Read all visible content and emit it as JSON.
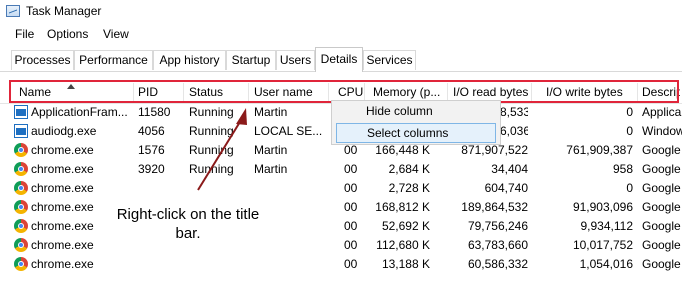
{
  "window": {
    "title": "Task Manager"
  },
  "menu": [
    "File",
    "Options",
    "View"
  ],
  "tabs": [
    "Processes",
    "Performance",
    "App history",
    "Startup",
    "Users",
    "Details",
    "Services"
  ],
  "active_tab": "Details",
  "columns": [
    "Name",
    "PID",
    "Status",
    "User name",
    "CPU",
    "Memory (p...",
    "I/O read bytes",
    "I/O write bytes",
    "Descrip"
  ],
  "rows": [
    {
      "name": "ApplicationFram...",
      "pid": "11580",
      "status": "Running",
      "user": "Martin",
      "cpu": "",
      "memory": "",
      "io_read": "8,533",
      "io_write": "0",
      "desc": "Applica",
      "icon": "window-app-icon"
    },
    {
      "name": "audiodg.exe",
      "pid": "4056",
      "status": "Running",
      "user": "LOCAL SE...",
      "cpu": "",
      "memory": "",
      "io_read": "6,036",
      "io_write": "0",
      "desc": "Window",
      "icon": "window-app-icon"
    },
    {
      "name": "chrome.exe",
      "pid": "1576",
      "status": "Running",
      "user": "Martin",
      "cpu": "00",
      "memory": "166,448 K",
      "io_read": "871,907,522",
      "io_write": "761,909,387",
      "desc": "Google",
      "icon": "chrome-icon"
    },
    {
      "name": "chrome.exe",
      "pid": "3920",
      "status": "Running",
      "user": "Martin",
      "cpu": "00",
      "memory": "2,684 K",
      "io_read": "34,404",
      "io_write": "958",
      "desc": "Google",
      "icon": "chrome-icon"
    },
    {
      "name": "chrome.exe",
      "pid": "",
      "status": "",
      "user": "",
      "cpu": "00",
      "memory": "2,728 K",
      "io_read": "604,740",
      "io_write": "0",
      "desc": "Google",
      "icon": "chrome-icon"
    },
    {
      "name": "chrome.exe",
      "pid": "",
      "status": "",
      "user": "",
      "cpu": "00",
      "memory": "168,812 K",
      "io_read": "189,864,532",
      "io_write": "91,903,096",
      "desc": "Google",
      "icon": "chrome-icon"
    },
    {
      "name": "chrome.exe",
      "pid": "",
      "status": "",
      "user": "",
      "cpu": "00",
      "memory": "52,692 K",
      "io_read": "79,756,246",
      "io_write": "9,934,112",
      "desc": "Google",
      "icon": "chrome-icon"
    },
    {
      "name": "chrome.exe",
      "pid": "",
      "status": "",
      "user": "",
      "cpu": "00",
      "memory": "112,680 K",
      "io_read": "63,783,660",
      "io_write": "10,017,752",
      "desc": "Google",
      "icon": "chrome-icon"
    },
    {
      "name": "chrome.exe",
      "pid": "",
      "status": "",
      "user": "",
      "cpu": "00",
      "memory": "13,188 K",
      "io_read": "60,586,332",
      "io_write": "1,054,016",
      "desc": "Google",
      "icon": "chrome-icon"
    }
  ],
  "context_menu": {
    "items": [
      "Hide column",
      "Select columns"
    ],
    "selected": "Select columns"
  },
  "annotation": {
    "text": "Right-click on the title bar.",
    "color": "#8b1a1a"
  },
  "colors": {
    "highlight": "#e0253a",
    "menu_selected": "#e5f1fb"
  }
}
